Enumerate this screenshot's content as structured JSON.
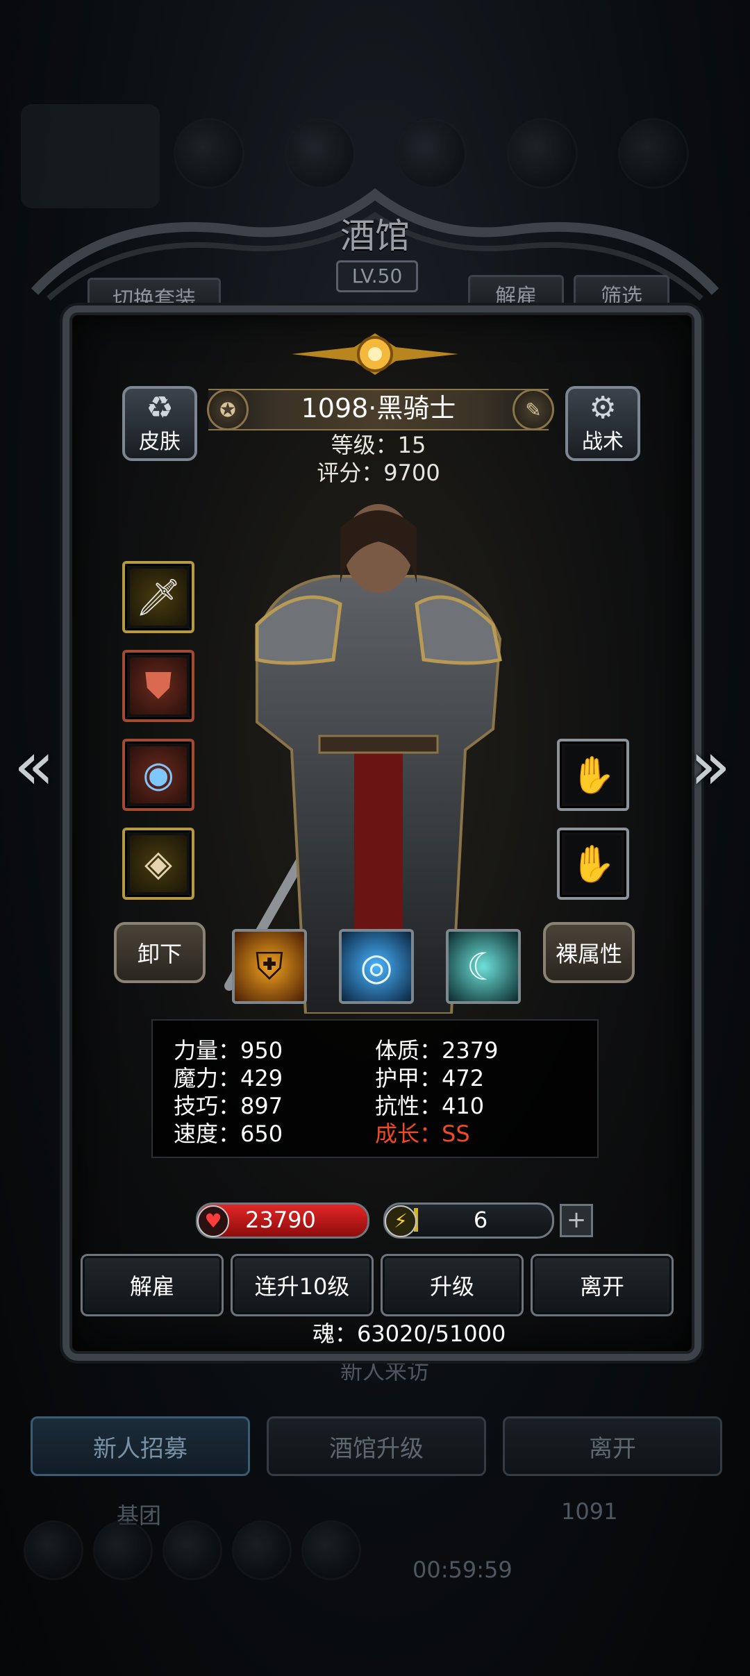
{
  "background": {
    "tavern_title": "酒馆",
    "tavern_level": "LV.50",
    "switch_outfit": "切换套装",
    "dismiss_tab": "解雇",
    "filter_tab": "筛选",
    "newcomer_label": "新人来访",
    "buttons": [
      "新人招募",
      "酒馆升级",
      "离开"
    ],
    "guild_label": "基团",
    "timer": "00:59:59",
    "gold_count": "1091"
  },
  "hero": {
    "name": "1098·黑骑士",
    "level_label": "等级：15",
    "score_label": "评分：9700",
    "skin_label": "皮肤",
    "tactics_label": "战术",
    "unequip_label": "卸下",
    "base_attr_label": "裸属性"
  },
  "equipment": {
    "left": [
      "sword-icon",
      "armor-icon",
      "amulet-icon",
      "scroll-icon"
    ],
    "right": [
      "gauntlet-icon",
      "gauntlet-icon"
    ]
  },
  "skills": [
    "shield-skill-icon",
    "eye-skill-icon",
    "slash-skill-icon"
  ],
  "stats": {
    "str": "力量：950",
    "con": "体质：2379",
    "mag": "魔力：429",
    "arm": "护甲：472",
    "skl": "技巧：897",
    "res": "抗性：410",
    "spd": "速度：650",
    "growth": "成长：SS"
  },
  "bars": {
    "hp": "23790",
    "energy": "6",
    "plus": "+"
  },
  "actions": [
    "解雇",
    "连升10级",
    "升级",
    "离开"
  ],
  "soul": "魂：63020/51000",
  "colors": {
    "accent_gold": "#8a7448",
    "growth_red": "#ef4a24",
    "hp_red": "#e32626"
  }
}
